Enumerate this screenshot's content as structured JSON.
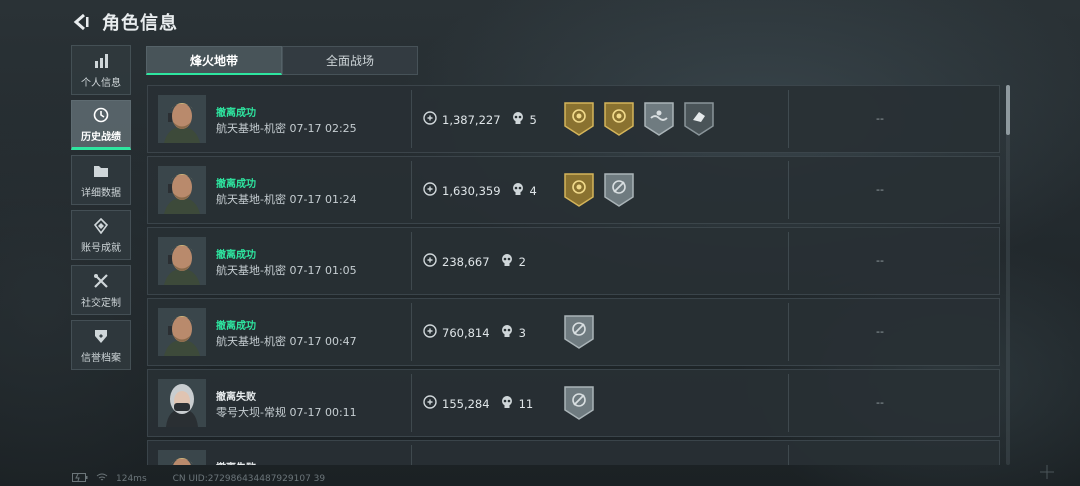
{
  "header": {
    "title": "角色信息",
    "back_icon": "back-arrow-icon"
  },
  "sidebar": {
    "items": [
      {
        "label": "个人信息",
        "icon": "bar-chart-icon",
        "active": false
      },
      {
        "label": "历史战绩",
        "icon": "history-clock-icon",
        "active": true
      },
      {
        "label": "详细数据",
        "icon": "folder-icon",
        "active": false
      },
      {
        "label": "账号成就",
        "icon": "diamond-badge-icon",
        "active": false
      },
      {
        "label": "社交定制",
        "icon": "tools-icon",
        "active": false
      },
      {
        "label": "信誉档案",
        "icon": "shield-heart-icon",
        "active": false
      }
    ]
  },
  "tabs": [
    {
      "label": "烽火地带",
      "active": true
    },
    {
      "label": "全面战场",
      "active": false
    }
  ],
  "records": [
    {
      "result": "撤离成功",
      "result_color": "#2ee6a0",
      "map": "航天基地-机密",
      "time": "07-17 02:25",
      "value": "1,387,227",
      "kills": "5",
      "avatar": "male-operator",
      "badges": [
        "gold",
        "gold",
        "silver-wave",
        "dark-hand"
      ],
      "extra": "--"
    },
    {
      "result": "撤离成功",
      "result_color": "#2ee6a0",
      "map": "航天基地-机密",
      "time": "07-17 01:24",
      "value": "1,630,359",
      "kills": "4",
      "avatar": "male-operator",
      "badges": [
        "gold",
        "silver-cross"
      ],
      "extra": "--"
    },
    {
      "result": "撤离成功",
      "result_color": "#2ee6a0",
      "map": "航天基地-机密",
      "time": "07-17 01:05",
      "value": "238,667",
      "kills": "2",
      "avatar": "male-operator",
      "badges": [],
      "extra": "--"
    },
    {
      "result": "撤离成功",
      "result_color": "#2ee6a0",
      "map": "航天基地-机密",
      "time": "07-17 00:47",
      "value": "760,814",
      "kills": "3",
      "avatar": "male-operator",
      "badges": [
        "silver-cross"
      ],
      "extra": "--"
    },
    {
      "result": "撤离失败",
      "result_color": "#e8ecee",
      "map": "零号大坝-常规",
      "time": "07-17 00:11",
      "value": "155,284",
      "kills": "11",
      "avatar": "female-operator",
      "badges": [
        "silver-cross"
      ],
      "extra": "--"
    },
    {
      "result": "撤离失败",
      "result_color": "#e8ecee",
      "map": "",
      "time": "",
      "value": "",
      "kills": "",
      "avatar": "male-operator",
      "badges": [],
      "extra": ""
    }
  ],
  "status_bar": {
    "ping": "124ms",
    "uid": "CN UID:272986434487929107 39"
  },
  "colors": {
    "accent": "#2ee6a0",
    "gold_badge": "#b8963c",
    "silver_badge": "#6f7b80"
  }
}
